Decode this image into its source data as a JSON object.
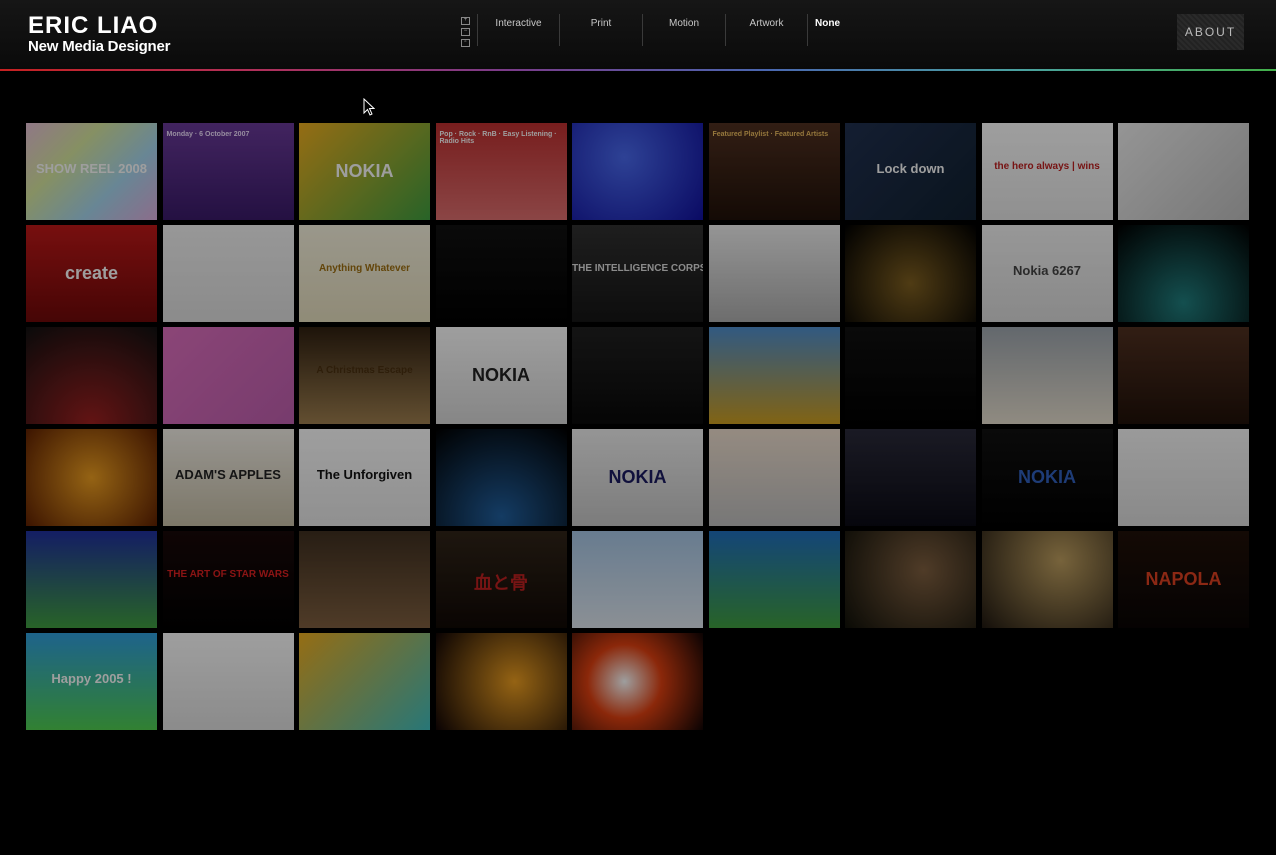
{
  "header": {
    "logo_name": "ERIC LIAO",
    "logo_tagline": "New Media Designer",
    "about_label": "ABOUT"
  },
  "view_icons": [
    "grid-plus",
    "grid-minus",
    "popout"
  ],
  "nav": {
    "items": [
      {
        "label": "Interactive",
        "active": false
      },
      {
        "label": "Print",
        "active": false
      },
      {
        "label": "Motion",
        "active": false
      },
      {
        "label": "Artwork",
        "active": false
      },
      {
        "label": "None",
        "active": true
      }
    ]
  },
  "portfolio": {
    "thumbs": [
      {
        "bg": "linear-gradient(135deg,#e8c2d8,#d8e8a0,#a8d8f0,#e0b0e0)",
        "caption": "SHOW REEL 2008",
        "color": "#ffffff"
      },
      {
        "bg": "linear-gradient(#6a3a9a,#3a1a6a)",
        "caption": "Monday · 6 October 2007",
        "color": "#f0e0ff"
      },
      {
        "bg": "linear-gradient(135deg,#f0b020,#40a040)",
        "caption": "NOKIA",
        "color": "#ffffff"
      },
      {
        "bg": "linear-gradient(#c03030,#e07070)",
        "caption": "Pop · Rock · RnB · Easy Listening · Radio Hits",
        "color": "#ffffff"
      },
      {
        "bg": "radial-gradient(circle at 40% 35%,#4a6af0,#1010a0)",
        "caption": "",
        "color": "#ffffff"
      },
      {
        "bg": "linear-gradient(#503020,#201008)",
        "caption": "Featured Playlist · Featured Artists",
        "color": "#f0c060"
      },
      {
        "bg": "linear-gradient(135deg,#203050,#102030)",
        "caption": "Lock down",
        "color": "#ffffff"
      },
      {
        "bg": "linear-gradient(#ffffff,#e8e8e8)",
        "caption": "the hero always | wins",
        "color": "#c02020"
      },
      {
        "bg": "linear-gradient(135deg,#f0f0f0,#c0c0c0)",
        "caption": "",
        "color": "#333333"
      },
      {
        "bg": "linear-gradient(#c01818,#700808)",
        "caption": "create",
        "color": "#ffffff"
      },
      {
        "bg": "linear-gradient(#f4f4f4,#e0e0e0)",
        "caption": "",
        "color": "#333333"
      },
      {
        "bg": "linear-gradient(#f8f4e0,#e8e0c0)",
        "caption": "Anything Whatever",
        "color": "#a07010"
      },
      {
        "bg": "linear-gradient(#101010,#000000)",
        "caption": "",
        "color": "#ffffff"
      },
      {
        "bg": "linear-gradient(#303030,#151515)",
        "caption": "THE INTELLIGENCE CORPS",
        "color": "#e0e0e0"
      },
      {
        "bg": "linear-gradient(#f0f0f0,#b0b0b0)",
        "caption": "",
        "color": "#333333"
      },
      {
        "bg": "radial-gradient(circle at 50% 60%,#806020,#000000)",
        "caption": "",
        "color": "#ffd080"
      },
      {
        "bg": "linear-gradient(#f4f4f4,#dcdcdc)",
        "caption": "Nokia 6267",
        "color": "#444444"
      },
      {
        "bg": "radial-gradient(circle at 50% 80%,#208080,#000000)",
        "caption": "",
        "color": "#ffffff"
      },
      {
        "bg": "radial-gradient(circle at 50% 100%,#a02020,#101010)",
        "caption": "",
        "color": "#ffffff"
      },
      {
        "bg": "linear-gradient(135deg,#e070c0,#c060b0)",
        "caption": "",
        "color": "#ffffff"
      },
      {
        "bg": "linear-gradient(#302010,#a08050)",
        "caption": "A Christmas Escape",
        "color": "#4a3010"
      },
      {
        "bg": "linear-gradient(#ffffff,#d8d8d8)",
        "caption": "NOKIA",
        "color": "#222222"
      },
      {
        "bg": "linear-gradient(#202020,#080808)",
        "caption": "",
        "color": "#ffffff"
      },
      {
        "bg": "linear-gradient(#5090d0,#d0a020)",
        "caption": "",
        "color": "#ffffff"
      },
      {
        "bg": "linear-gradient(#101010,#000000)",
        "caption": "",
        "color": "#ffffff"
      },
      {
        "bg": "linear-gradient(#a0a8b0,#e8e0d0)",
        "caption": "",
        "color": "#333333"
      },
      {
        "bg": "linear-gradient(#503020,#201008)",
        "caption": "",
        "color": "#ffffff"
      },
      {
        "bg": "radial-gradient(circle,#f0a020,#602000)",
        "caption": "",
        "color": "#ffffff"
      },
      {
        "bg": "linear-gradient(#f4f0e8,#c8c0a8)",
        "caption": "ADAM'S APPLES",
        "color": "#222222"
      },
      {
        "bg": "linear-gradient(#ffffff,#e8e8e8)",
        "caption": "The Unforgiven",
        "color": "#111111"
      },
      {
        "bg": "radial-gradient(circle at 50% 90%,#2060a0,#000000)",
        "caption": "",
        "color": "#ffffff"
      },
      {
        "bg": "linear-gradient(#f0f0f0,#c8c8c8)",
        "caption": "NOKIA",
        "color": "#1a1a60"
      },
      {
        "bg": "linear-gradient(#f0e0d0,#c0c0c0)",
        "caption": "",
        "color": "#333333"
      },
      {
        "bg": "linear-gradient(#2a2a3a,#0a0a14)",
        "caption": "",
        "color": "#ffffff"
      },
      {
        "bg": "linear-gradient(#101010,#000000)",
        "caption": "NOKIA",
        "color": "#3060c0"
      },
      {
        "bg": "linear-gradient(#f8f8f8,#dddddd)",
        "caption": "",
        "color": "#333333"
      },
      {
        "bg": "linear-gradient(#2030a0,#40a040)",
        "caption": "",
        "color": "#ffffff"
      },
      {
        "bg": "linear-gradient(#180808,#000000)",
        "caption": "THE ART OF STAR WARS",
        "color": "#e02020"
      },
      {
        "bg": "linear-gradient(#403020,#806040)",
        "caption": "",
        "color": "#ffffff"
      },
      {
        "bg": "linear-gradient(#302418,#100804)",
        "caption": "血と骨",
        "color": "#c02020"
      },
      {
        "bg": "linear-gradient(#a8c8e8,#e0e8f0)",
        "caption": "",
        "color": "#333333"
      },
      {
        "bg": "linear-gradient(#2070c0,#40a040)",
        "caption": "",
        "color": "#ffffff"
      },
      {
        "bg": "radial-gradient(circle at 60% 40%,#806040,#101008)",
        "caption": "",
        "color": "#ffffff"
      },
      {
        "bg": "radial-gradient(circle at 60% 30%,#c0a060,#201810)",
        "caption": "",
        "color": "#ffffff"
      },
      {
        "bg": "linear-gradient(#201008,#080404)",
        "caption": "NAPOLA",
        "color": "#e04020"
      },
      {
        "bg": "linear-gradient(#30a0e0,#50d050)",
        "caption": "Happy 2005 !",
        "color": "#ffffff"
      },
      {
        "bg": "linear-gradient(#ffffff,#e0e0e0)",
        "caption": "",
        "color": "#333333"
      },
      {
        "bg": "linear-gradient(135deg,#f0b020,#40c0c0)",
        "caption": "",
        "color": "#ffffff"
      },
      {
        "bg": "radial-gradient(circle at 60% 50%,#f0a020,#100404)",
        "caption": "",
        "color": "#ffffff"
      },
      {
        "bg": "radial-gradient(circle at 40% 50%,#ffffff,#e04010 40%,#100404)",
        "caption": "",
        "color": "#ffffff"
      }
    ]
  }
}
